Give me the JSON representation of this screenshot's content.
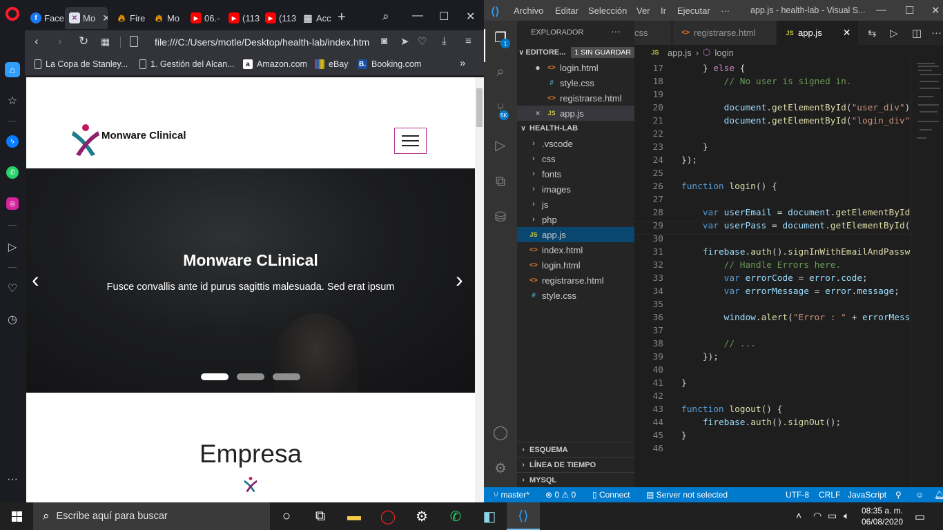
{
  "opera": {
    "tabs": [
      {
        "label": "Face",
        "favicon": "facebook-icon"
      },
      {
        "label": "Mo",
        "favicon": "monware-icon"
      },
      {
        "label": "Fire",
        "favicon": "firebase-icon"
      },
      {
        "label": "Mo",
        "favicon": "firebase-icon"
      },
      {
        "label": "06.-",
        "favicon": "youtube-icon"
      },
      {
        "label": "(113",
        "favicon": "youtube-icon"
      },
      {
        "label": "(113",
        "favicon": "youtube-icon"
      },
      {
        "label": "Acc",
        "favicon": "apps-icon"
      }
    ],
    "url": "file:///C:/Users/motle/Desktop/health-lab/index.htm",
    "bookmarks": [
      {
        "label": "La Copa de Stanley...",
        "icon": "page-icon"
      },
      {
        "label": "1. Gestión del Alcan...",
        "icon": "page-icon"
      },
      {
        "label": "Amazon.com",
        "icon": "amazon-icon"
      },
      {
        "label": "eBay",
        "icon": "ebay-icon"
      },
      {
        "label": "Booking.com",
        "icon": "booking-icon"
      }
    ]
  },
  "webpage": {
    "brand": "Monware Clinical",
    "carousel_title": "Monware CLinical",
    "carousel_caption": "Fusce convallis ante id purus sagittis malesuada. Sed erat ipsum",
    "section_title": "Empresa"
  },
  "vscode": {
    "menu": [
      "Archivo",
      "Editar",
      "Selección",
      "Ver",
      "Ir",
      "Ejecutar",
      "···"
    ],
    "window_title": "app.js - health-lab - Visual S...",
    "explorer_title": "EXPLORADOR",
    "open_editors": {
      "label": "EDITORE...",
      "badge": "1 SIN GUARDAR",
      "files": [
        {
          "name": "login.html",
          "type": "html",
          "mark": "●"
        },
        {
          "name": "style.css",
          "type": "css",
          "mark": ""
        },
        {
          "name": "registrarse.html",
          "type": "html",
          "mark": ""
        },
        {
          "name": "app.js",
          "type": "js",
          "mark": "×"
        }
      ]
    },
    "project": {
      "label": "HEALTH-LAB",
      "folders": [
        ".vscode",
        "css",
        "fonts",
        "images",
        "js",
        "php"
      ],
      "files": [
        {
          "name": "app.js",
          "type": "js"
        },
        {
          "name": "index.html",
          "type": "html"
        },
        {
          "name": "login.html",
          "type": "html"
        },
        {
          "name": "registrarse.html",
          "type": "html"
        },
        {
          "name": "style.css",
          "type": "css"
        }
      ]
    },
    "bottom_sections": [
      "ESQUEMA",
      "LÍNEA DE TIEMPO",
      "MYSQL"
    ],
    "editor_tabs": [
      {
        "label": "css",
        "type": "css"
      },
      {
        "label": "registrarse.html",
        "type": "html"
      },
      {
        "label": "app.js",
        "type": "js"
      }
    ],
    "breadcrumbs": {
      "file": "app.js",
      "symbol": "login"
    },
    "line_numbers": [
      "17",
      "18",
      "19",
      "20",
      "21",
      "22",
      "23",
      "24",
      "25",
      "26",
      "27",
      "28",
      "29",
      "30",
      "31",
      "32",
      "33",
      "34",
      "35",
      "36",
      "37",
      "38",
      "39",
      "40",
      "41",
      "42",
      "43",
      "44",
      "45",
      "46"
    ],
    "source_control_badge": "5K",
    "explorer_badge": "1",
    "status": {
      "branch": "master*",
      "errors": "0",
      "warnings": "0",
      "connect": "Connect",
      "server": "Server not selected",
      "encoding": "UTF-8",
      "eol": "CRLF",
      "language": "JavaScript"
    }
  },
  "taskbar": {
    "search_placeholder": "Escribe aquí para buscar",
    "time": "08:35 a. m.",
    "date": "06/08/2020"
  }
}
